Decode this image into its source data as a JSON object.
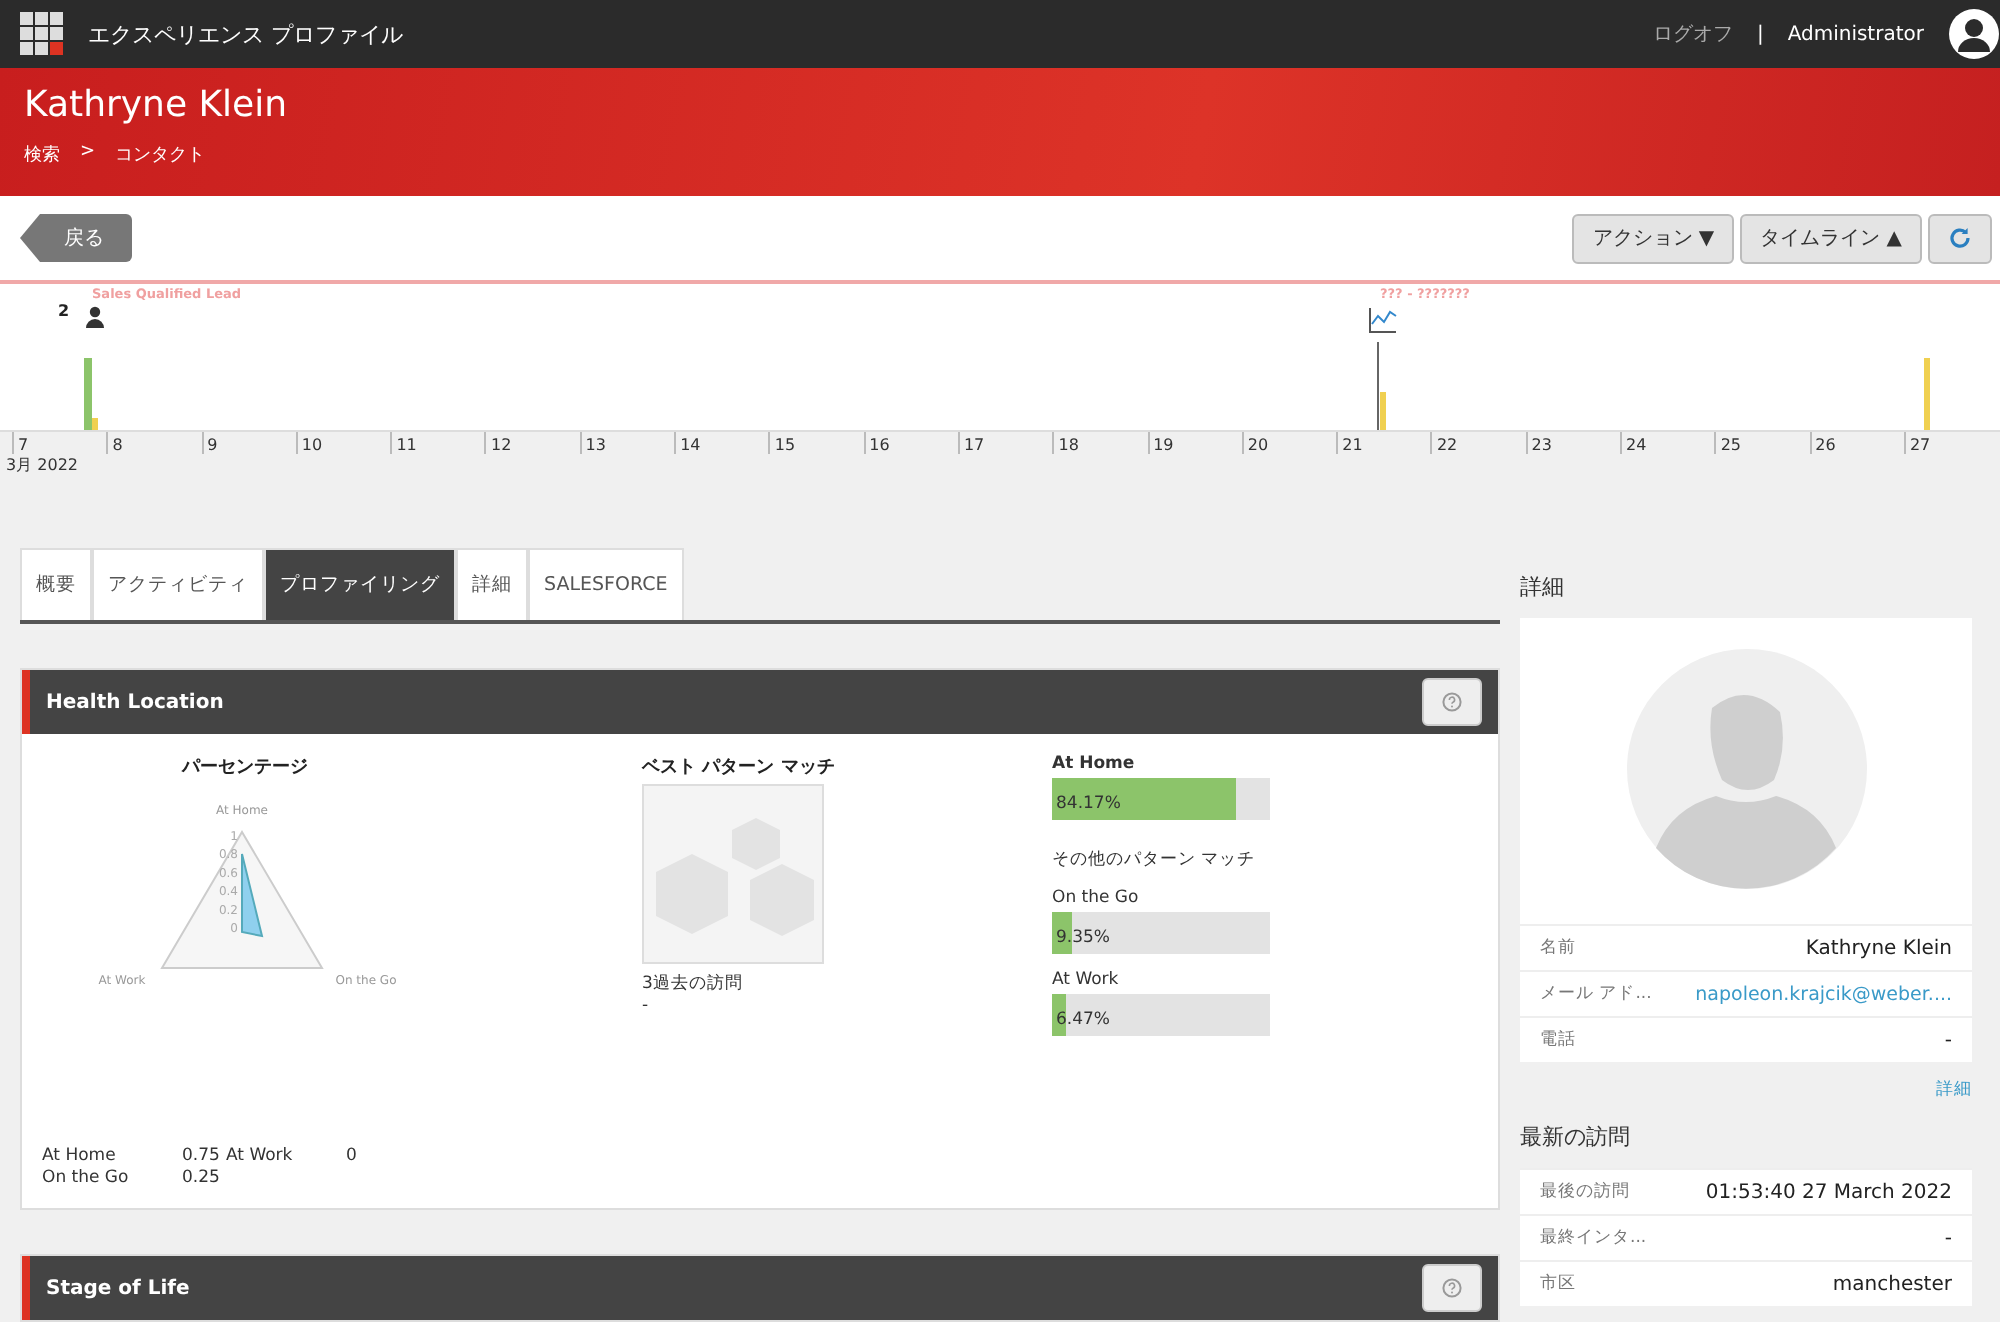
{
  "topbar": {
    "app_title": "エクスペリエンス プロファイル",
    "logoff": "ログオフ",
    "separator": "|",
    "user": "Administrator"
  },
  "header": {
    "title": "Kathryne Klein",
    "breadcrumb": [
      "検索",
      "コンタクト"
    ],
    "breadcrumb_separator": ">"
  },
  "toolbar": {
    "back": "戻る",
    "actions": "アクション ▼",
    "timeline": "タイムライン ▲"
  },
  "timeline": {
    "count": "2",
    "events": [
      {
        "label": "Sales Qualified Lead",
        "kind": "lead"
      },
      {
        "label": "??? - ???????",
        "kind": "goal"
      }
    ],
    "month": "3月 2022",
    "days": [
      "7",
      "8",
      "9",
      "10",
      "11",
      "12",
      "13",
      "14",
      "15",
      "16",
      "17",
      "18",
      "19",
      "20",
      "21",
      "22",
      "23",
      "24",
      "25",
      "26",
      "27"
    ]
  },
  "tabs": [
    {
      "label": "概要",
      "selected": false
    },
    {
      "label": "アクティビティ",
      "selected": false
    },
    {
      "label": "プロファイリング",
      "selected": true
    },
    {
      "label": "詳細",
      "selected": false
    },
    {
      "label": "SALESFORCE",
      "selected": false
    }
  ],
  "health": {
    "title": "Health Location",
    "percentage_title": "パーセンテージ",
    "radar": {
      "axes": [
        "At Home",
        "On the Go",
        "At Work"
      ],
      "ticks": [
        "1",
        "0.8",
        "0.6",
        "0.4",
        "0.2",
        "0"
      ]
    },
    "scores": [
      {
        "label": "At Home",
        "value": "0.75"
      },
      {
        "label": "At Work",
        "value": "0"
      },
      {
        "label": "On the Go",
        "value": "0.25"
      }
    ],
    "best_title": "ベスト パターン マッチ",
    "visits": "3過去の訪問",
    "visits_value": "-",
    "best": {
      "label": "At Home",
      "reading": "84.17%",
      "level": 0.8417
    },
    "other_title": "その他のパターン マッチ",
    "others": [
      {
        "label": "On the Go",
        "reading": "9.35%",
        "level": 0.0935
      },
      {
        "label": "At Work",
        "reading": "6.47%",
        "level": 0.0647
      }
    ]
  },
  "stage": {
    "title": "Stage of Life"
  },
  "details": {
    "title": "詳細",
    "rows": [
      {
        "label": "名前",
        "value": "Kathryne Klein",
        "kind": "text"
      },
      {
        "label": "メール アド...",
        "value": "napoleon.krajcik@weber....",
        "kind": "link"
      },
      {
        "label": "電話",
        "value": "-",
        "kind": "text"
      }
    ],
    "more": "詳細"
  },
  "visit": {
    "title": "最新の訪問",
    "rows": [
      {
        "label": "最後の訪問",
        "value": "01:53:40 27 March 2022"
      },
      {
        "label": "最終インタ...",
        "value": "-"
      },
      {
        "label": "市区",
        "value": "manchester"
      }
    ]
  }
}
